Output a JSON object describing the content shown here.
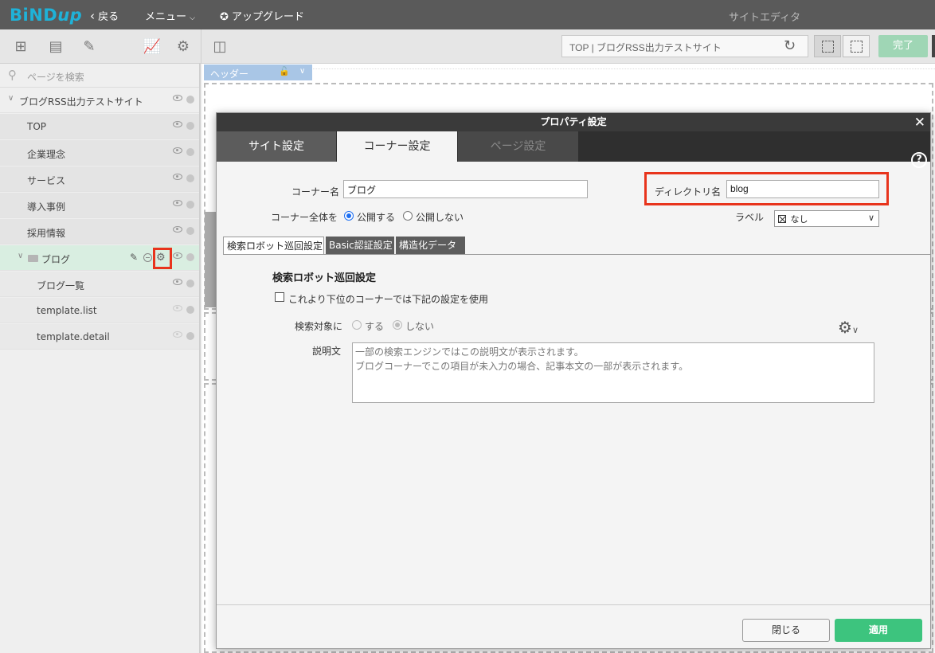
{
  "app": {
    "logo": {
      "p1": "BiND",
      "p2": "up"
    },
    "back_label": "戻る",
    "menu_label": "メニュー",
    "upgrade_label": "アップグレード",
    "window_title": "サイトエディタ"
  },
  "toolbar": {
    "url_text": "TOP | ブログRSS出力テストサイト",
    "done_label": "完了"
  },
  "sidebar": {
    "search_placeholder": "ページを検索",
    "site_name": "ブログRSS出力テストサイト",
    "pages": [
      {
        "label": "TOP",
        "visible": true
      },
      {
        "label": "企業理念",
        "visible": true
      },
      {
        "label": "サービス",
        "visible": true
      },
      {
        "label": "導入事例",
        "visible": true
      },
      {
        "label": "採用情報",
        "visible": true
      }
    ],
    "corner": {
      "label": "ブログ"
    },
    "sub_pages": [
      {
        "label": "ブログ一覧",
        "visible": true
      },
      {
        "label": "template.list",
        "visible": false
      },
      {
        "label": "template.detail",
        "visible": false
      }
    ]
  },
  "canvas": {
    "header_tab_label": "ヘッダー"
  },
  "dialog": {
    "title": "プロパティ設定",
    "tabs": [
      "サイト設定",
      "コーナー設定",
      "ページ設定"
    ],
    "active_tab": "コーナー設定",
    "corner_name_label": "コーナー名",
    "corner_name_value": "ブログ",
    "directory_label": "ディレクトリ名",
    "directory_value": "blog",
    "corner_all_label": "コーナー全体を",
    "publish_label": "公開する",
    "unpublish_label": "公開しない",
    "publish_selected": "公開する",
    "label_label": "ラベル",
    "label_value": "なし",
    "sub_tabs": [
      "検索ロボット巡回設定",
      "Basic認証設定",
      "構造化データ"
    ],
    "section_title": "検索ロボット巡回設定",
    "checkbox_label": "これより下位のコーナーでは下記の設定を使用",
    "checkbox_checked": false,
    "search_target_label": "検索対象に",
    "target_yes": "する",
    "target_no": "しない",
    "target_selected": "しない",
    "description_label": "説明文",
    "description_lines": [
      "一部の検索エンジンではこの説明文が表示されます。",
      "ブログコーナーでこの項目が未入力の場合、記事本文の一部が表示されます。"
    ],
    "close_button": "閉じる",
    "apply_button": "適用"
  },
  "colors": {
    "accent_green": "#3dc47e",
    "highlight_red": "#e8341c",
    "brand_blue": "#1fb2d8"
  }
}
